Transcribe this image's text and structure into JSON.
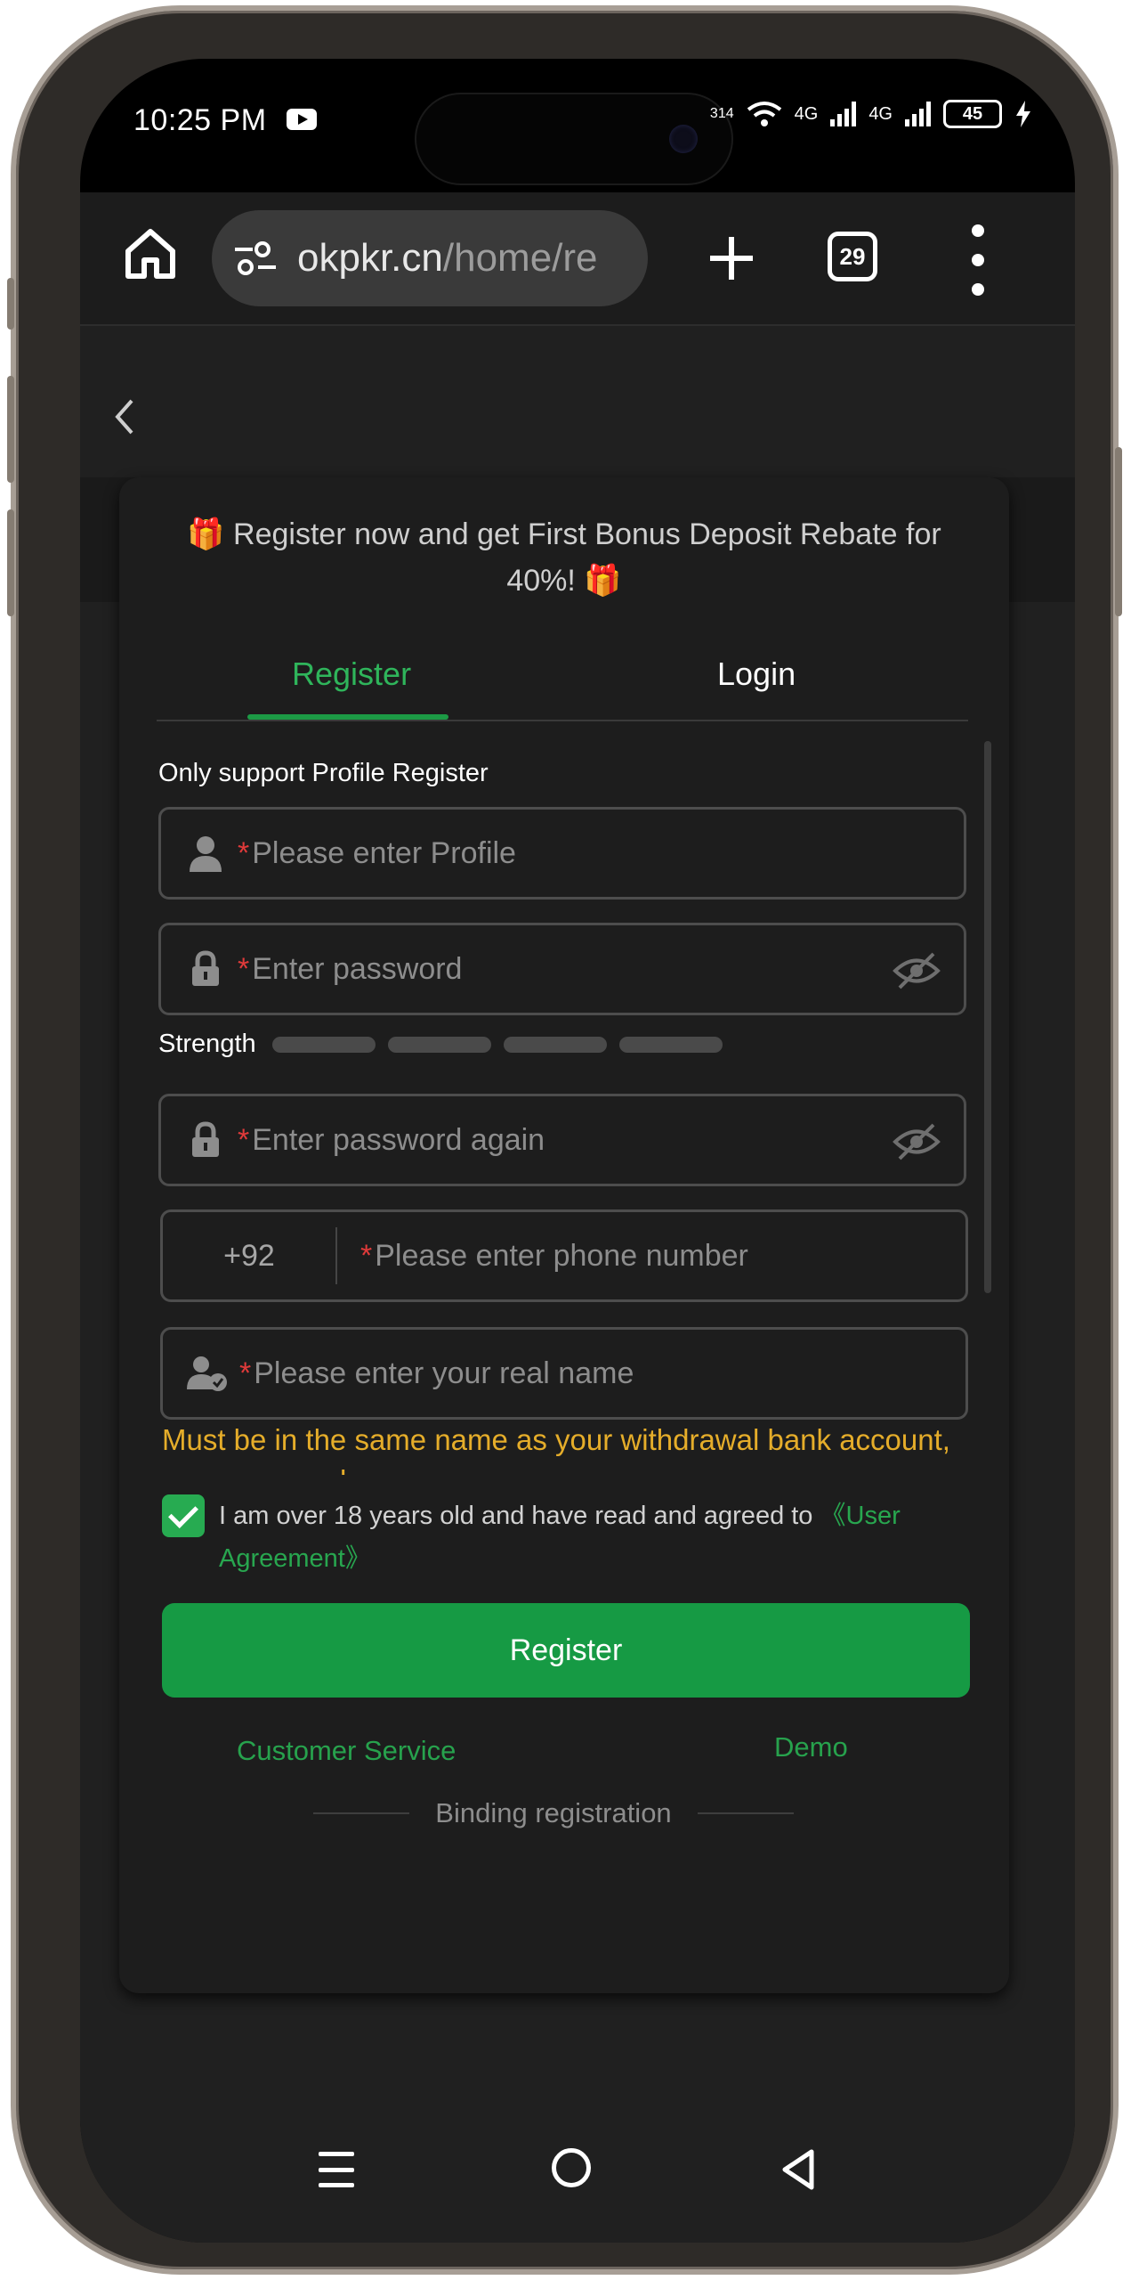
{
  "status_bar": {
    "time": "10:25 PM",
    "network_speed": "314",
    "network_1": "4G",
    "network_2": "4G",
    "battery": "45"
  },
  "browser": {
    "url_host": "okpkr.cn",
    "url_path": "/home/re",
    "tab_count": "29"
  },
  "promo": {
    "text": "🎁 Register now and get First Bonus Deposit Rebate for 40%! 🎁"
  },
  "tabs": {
    "register": "Register",
    "login": "Login",
    "active": "Register"
  },
  "form": {
    "note": "Only support Profile Register",
    "required_mark": "*",
    "profile_placeholder": "Please enter Profile",
    "password_placeholder": "Enter password",
    "strength_label": "Strength",
    "password_again_placeholder": "Enter password again",
    "phone_prefix": "+92",
    "phone_placeholder": "Please enter phone number",
    "real_name_placeholder": "Please enter your real name",
    "real_name_warning": "Must be in the same name as your withdrawal bank account, uppercase only",
    "agree_text": "I am over 18 years old and have read and agreed to ",
    "agree_link": "《User Agreement》",
    "agree_checked": true,
    "register_button": "Register",
    "customer_service": "Customer Service",
    "demo": "Demo",
    "binding": "Binding registration"
  },
  "colors": {
    "accent_green": "#169a44",
    "warning_yellow": "#e5ad2a",
    "required_red": "#e03a3a"
  }
}
